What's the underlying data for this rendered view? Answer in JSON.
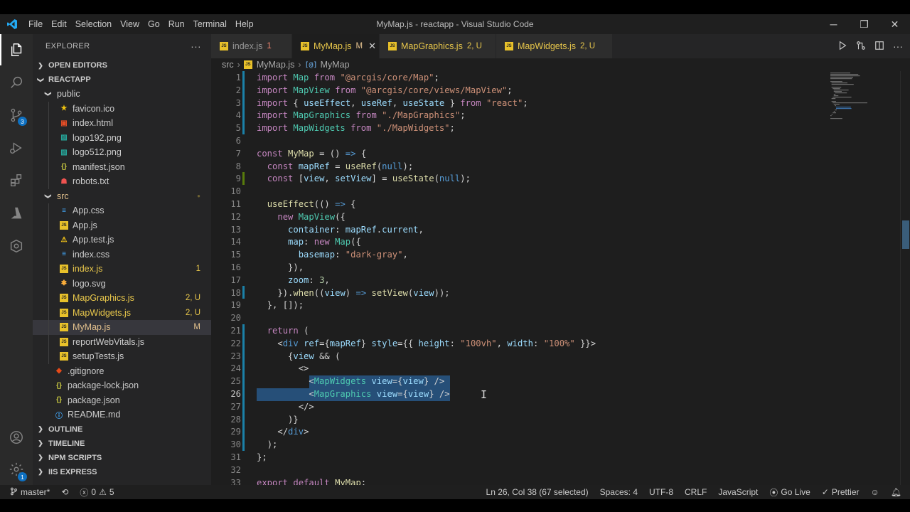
{
  "window": {
    "title": "MyMap.js - reactapp - Visual Studio Code"
  },
  "menu": [
    "File",
    "Edit",
    "Selection",
    "View",
    "Go",
    "Run",
    "Terminal",
    "Help"
  ],
  "sidebar": {
    "title": "EXPLORER",
    "more": "···",
    "sections": {
      "open_editors": "OPEN EDITORS",
      "reactapp": "REACTAPP",
      "outline": "OUTLINE",
      "timeline": "TIMELINE",
      "npm_scripts": "NPM SCRIPTS",
      "iis_express": "IIS EXPRESS"
    },
    "tree": [
      {
        "label": "public",
        "kind": "folder",
        "deco": ""
      },
      {
        "label": "favicon.ico",
        "kind": "star",
        "deco": ""
      },
      {
        "label": "index.html",
        "kind": "html",
        "deco": ""
      },
      {
        "label": "logo192.png",
        "kind": "image",
        "deco": ""
      },
      {
        "label": "logo512.png",
        "kind": "image",
        "deco": ""
      },
      {
        "label": "manifest.json",
        "kind": "json",
        "deco": ""
      },
      {
        "label": "robots.txt",
        "kind": "robot",
        "deco": ""
      },
      {
        "label": "src",
        "kind": "folder",
        "deco": "●"
      },
      {
        "label": "App.css",
        "kind": "css",
        "deco": ""
      },
      {
        "label": "App.js",
        "kind": "js",
        "deco": ""
      },
      {
        "label": "App.test.js",
        "kind": "test",
        "deco": ""
      },
      {
        "label": "index.css",
        "kind": "css",
        "deco": ""
      },
      {
        "label": "index.js",
        "kind": "js",
        "deco": "1"
      },
      {
        "label": "logo.svg",
        "kind": "svg",
        "deco": ""
      },
      {
        "label": "MapGraphics.js",
        "kind": "js",
        "deco": "2, U"
      },
      {
        "label": "MapWidgets.js",
        "kind": "js",
        "deco": "2, U"
      },
      {
        "label": "MyMap.js",
        "kind": "js",
        "deco": "M"
      },
      {
        "label": "reportWebVitals.js",
        "kind": "js",
        "deco": ""
      },
      {
        "label": "setupTests.js",
        "kind": "js",
        "deco": ""
      },
      {
        "label": ".gitignore",
        "kind": "git",
        "deco": ""
      },
      {
        "label": "package-lock.json",
        "kind": "json",
        "deco": ""
      },
      {
        "label": "package.json",
        "kind": "json",
        "deco": ""
      },
      {
        "label": "README.md",
        "kind": "info",
        "deco": ""
      }
    ]
  },
  "tabs": [
    {
      "label": "index.js",
      "deco": "1"
    },
    {
      "label": "MyMap.js",
      "deco": "M"
    },
    {
      "label": "MapGraphics.js",
      "deco": "2, U"
    },
    {
      "label": "MapWidgets.js",
      "deco": "2, U"
    }
  ],
  "breadcrumb": {
    "folder": "src",
    "file": "MyMap.js",
    "symbol": "MyMap"
  },
  "activity_badges": {
    "scm": "3",
    "accounts": "1"
  },
  "colors": {
    "accent": "#0e70c0",
    "keyword": "#c586c0",
    "function": "#dcdcaa",
    "string": "#ce9178",
    "variable": "#9cdcfe",
    "component": "#4ec9b0",
    "modified": "#e2c08d",
    "untracked": "#73c991",
    "error": "#f48771"
  },
  "code_lines": [
    "import Map from \"@arcgis/core/Map\";",
    "import MapView from \"@arcgis/core/views/MapView\";",
    "import { useEffect, useRef, useState } from \"react\";",
    "import MapGraphics from \"./MapGraphics\";",
    "import MapWidgets from \"./MapWidgets\";",
    "",
    "const MyMap = () => {",
    "  const mapRef = useRef(null);",
    "  const [view, setView] = useState(null);",
    "",
    "  useEffect(() => {",
    "    new MapView({",
    "      container: mapRef.current,",
    "      map: new Map({",
    "        basemap: \"dark-gray\",",
    "      }),",
    "      zoom: 3,",
    "    }).when((view) => setView(view));",
    "  }, []);",
    "",
    "  return (",
    "    <div ref={mapRef} style={{ height: \"100vh\", width: \"100%\" }}>",
    "      {view && (",
    "        <>",
    "          <MapWidgets view={view} />",
    "          <MapGraphics view={view} />",
    "        </>",
    "      )}",
    "    </div>",
    "  );",
    "};",
    "",
    "export default MyMap;"
  ],
  "status": {
    "branch": "master*",
    "errors": "0",
    "warnings": "5",
    "position": "Ln 26, Col 38 (67 selected)",
    "spaces": "Spaces: 4",
    "encoding": "UTF-8",
    "eol": "CRLF",
    "language": "JavaScript",
    "go_live": "Go Live",
    "prettier": "Prettier"
  }
}
